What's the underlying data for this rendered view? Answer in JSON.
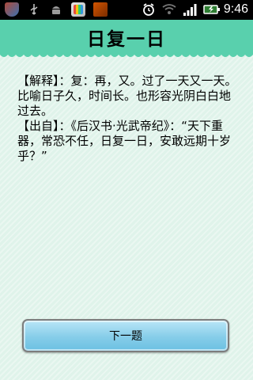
{
  "status_bar": {
    "time": "9:46",
    "icons": [
      "shield-icon",
      "usb-icon",
      "android-debug-icon",
      "game-app-icon",
      "book-app-icon",
      "alarm-icon",
      "wifi-icon",
      "signal-icon",
      "battery-charging-icon"
    ]
  },
  "header": {
    "title": "日复一日",
    "color": "#59d0ad"
  },
  "content": {
    "line1": "【解释】：复：再，又。过了一天又一天。比喻日子久，时间长。也形容光阴白白地过去。",
    "line2": "【出自】：《后汉书·光武帝纪》：“天下重器，常恐不任，日复一日，安敢远期十岁乎？”"
  },
  "button": {
    "label": "下一题"
  }
}
